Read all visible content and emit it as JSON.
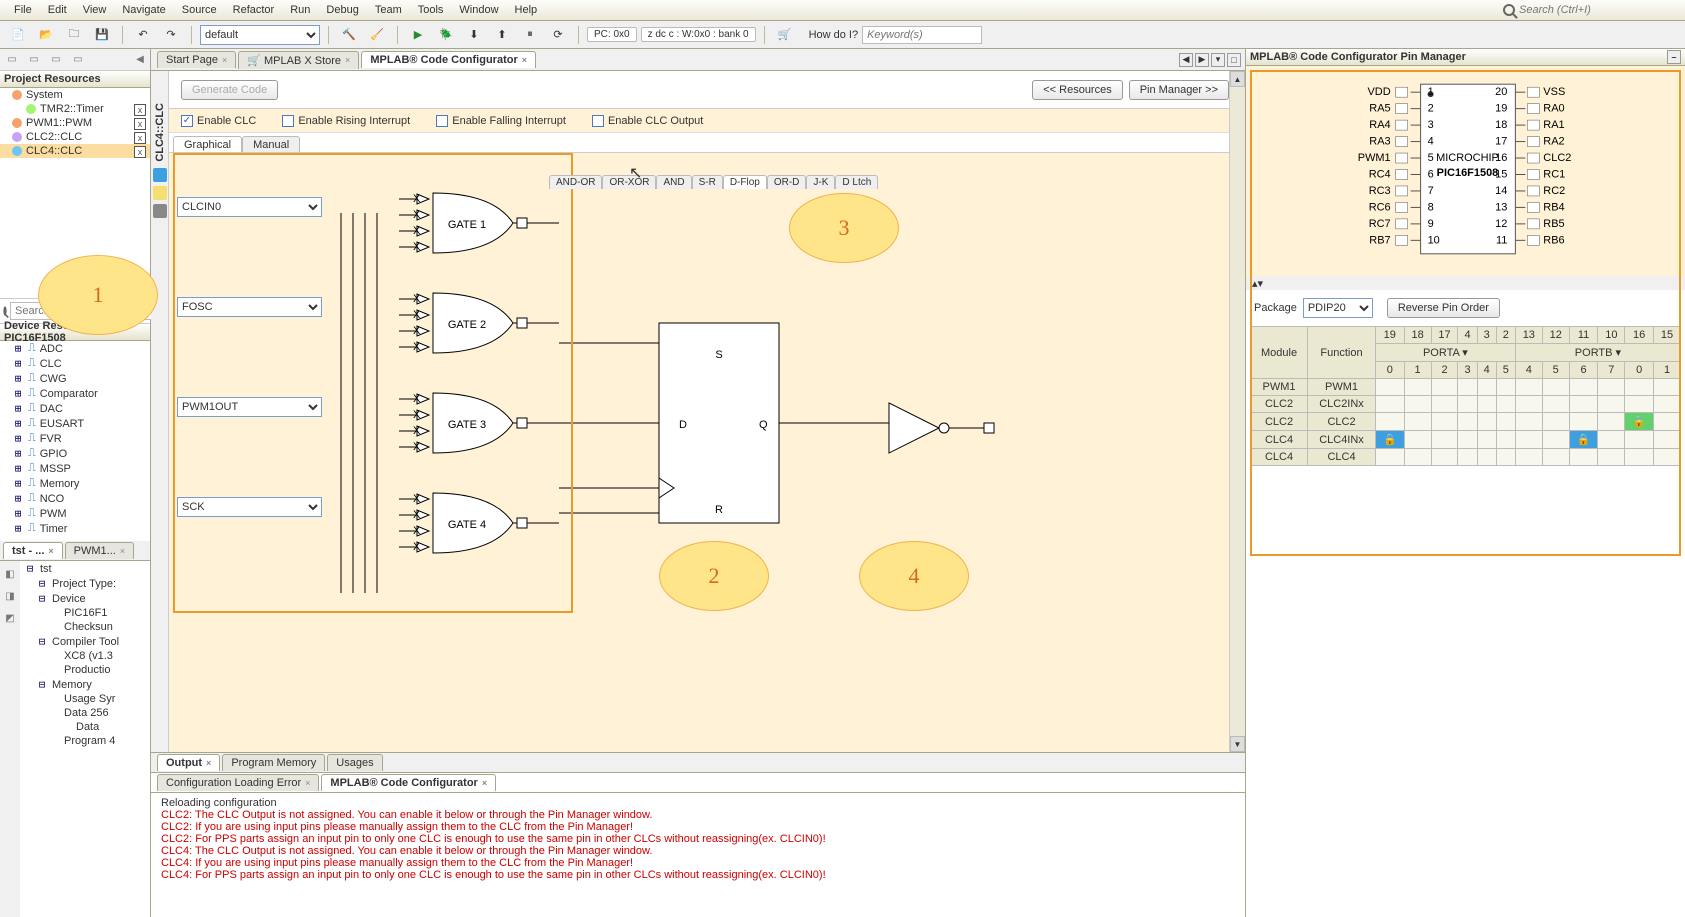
{
  "menubar": [
    "File",
    "Edit",
    "View",
    "Navigate",
    "Source",
    "Refactor",
    "Run",
    "Debug",
    "Team",
    "Tools",
    "Window",
    "Help"
  ],
  "search_placeholder": "Search (Ctrl+I)",
  "toolbar_combo": "default",
  "status_pc": "PC: 0x0",
  "status_bank": "z dc c  : W:0x0 : bank 0",
  "howdo_label": "How do I?",
  "howdo_placeholder": "Keyword(s)",
  "project_resources_title": "Project Resources",
  "project_resources": [
    {
      "label": "System",
      "indent": 0,
      "closable": false
    },
    {
      "label": "TMR2::Timer",
      "indent": 1,
      "closable": true
    },
    {
      "label": "PWM1::PWM",
      "indent": 0,
      "closable": true
    },
    {
      "label": "CLC2::CLC",
      "indent": 0,
      "closable": true
    },
    {
      "label": "CLC4::CLC",
      "indent": 0,
      "sel": true,
      "closable": true
    }
  ],
  "search_modules_ph": "Search for modules…",
  "device_res_title": "Device Resources - PIC16F1508",
  "device_list": [
    "ADC",
    "CLC",
    "CWG",
    "Comparator",
    "DAC",
    "EUSART",
    "FVR",
    "GPIO",
    "MSSP",
    "Memory",
    "NCO",
    "PWM",
    "Timer"
  ],
  "nav_tabs": [
    "tst - ...",
    "PWM1..."
  ],
  "nav_tree": [
    {
      "l": "tst",
      "i": 0
    },
    {
      "l": "Project Type:",
      "i": 1
    },
    {
      "l": "Device",
      "i": 1
    },
    {
      "l": "PIC16F1",
      "i": 2
    },
    {
      "l": "Checksun",
      "i": 2
    },
    {
      "l": "Compiler Tool",
      "i": 1
    },
    {
      "l": "XC8 (v1.3",
      "i": 2
    },
    {
      "l": "Productio",
      "i": 2
    },
    {
      "l": "Memory",
      "i": 1
    },
    {
      "l": "Usage Syr",
      "i": 2
    },
    {
      "l": "Data 256",
      "i": 2
    },
    {
      "l": "Data",
      "i": 3
    },
    {
      "l": "Program 4",
      "i": 2
    }
  ],
  "editor_tabs": [
    {
      "label": "Start Page"
    },
    {
      "label": "MPLAB X Store",
      "icon": true
    },
    {
      "label": "MPLAB® Code Configurator",
      "active": true
    }
  ],
  "gen_btn": "Generate Code",
  "res_btn": "<< Resources",
  "pin_btn": "Pin Manager >>",
  "opts": [
    {
      "label": "Enable CLC",
      "checked": true
    },
    {
      "label": "Enable Rising Interrupt",
      "checked": false
    },
    {
      "label": "Enable Falling Interrupt",
      "checked": false
    },
    {
      "label": "Enable CLC Output",
      "checked": false
    }
  ],
  "clc_vertical": "CLC4::CLC",
  "sub_tabs": [
    "Graphical",
    "Manual"
  ],
  "logic_tabs": [
    "AND-OR",
    "OR-XOR",
    "AND",
    "S-R",
    "D-Flop",
    "OR-D",
    "J-K",
    "D Ltch"
  ],
  "inputs": [
    "CLCIN0",
    "FOSC",
    "PWM1OUT",
    "SCK"
  ],
  "gates": [
    "GATE 1",
    "GATE 2",
    "GATE 3",
    "GATE 4"
  ],
  "ff": {
    "S": "S",
    "D": "D",
    "Q": "Q",
    "R": "R"
  },
  "bottom_tabs": [
    "Output",
    "Program Memory",
    "Usages"
  ],
  "sub_bottom_tabs": [
    "Configuration Loading Error",
    "MPLAB® Code Configurator"
  ],
  "console": [
    {
      "t": "Reloading configuration"
    },
    {
      "t": "CLC2: The CLC Output is not assigned. You can enable it below or through the Pin Manager window.",
      "c": "c-red"
    },
    {
      "t": "CLC2: If you are using input pins please manually assign them to the CLC from the Pin Manager!",
      "c": "c-red"
    },
    {
      "t": "CLC2: For PPS parts assign an input pin to only one CLC is enough to use the same pin in other CLCs without reassigning(ex. CLCIN0)!",
      "c": "c-red"
    },
    {
      "t": "CLC4: The CLC Output is not assigned. You can enable it below or through the Pin Manager window.",
      "c": "c-red"
    },
    {
      "t": "CLC4: If you are using input pins please manually assign them to the CLC from the Pin Manager!",
      "c": "c-red"
    },
    {
      "t": "CLC4: For PPS parts assign an input pin to only one CLC is enough to use the same pin in other CLCs without reassigning(ex. CLCIN0)!",
      "c": "c-red"
    }
  ],
  "pin_mgr_title": "MPLAB® Code Configurator Pin Manager",
  "chip_name": "PIC16F1508",
  "chip_pins_l": [
    {
      "n": "1",
      "name": "VDD",
      "c": null
    },
    {
      "n": "2",
      "name": "RA5",
      "c": null
    },
    {
      "n": "3",
      "name": "RA4",
      "c": null
    },
    {
      "n": "4",
      "name": "RA3",
      "c": null
    },
    {
      "n": "5",
      "name": "PWM1",
      "c": "green"
    },
    {
      "n": "6",
      "name": "RC4",
      "c": null
    },
    {
      "n": "7",
      "name": "RC3",
      "c": null
    },
    {
      "n": "8",
      "name": "RC6",
      "c": null
    },
    {
      "n": "9",
      "name": "RC7",
      "c": null
    },
    {
      "n": "10",
      "name": "RB7",
      "c": null
    }
  ],
  "chip_pins_r": [
    {
      "n": "20",
      "name": "VSS",
      "c": null
    },
    {
      "n": "19",
      "name": "RA0",
      "c": null
    },
    {
      "n": "18",
      "name": "RA1",
      "c": null
    },
    {
      "n": "17",
      "name": "RA2",
      "c": null
    },
    {
      "n": "16",
      "name": "CLC2",
      "c": "yellow"
    },
    {
      "n": "15",
      "name": "RC1",
      "c": null
    },
    {
      "n": "14",
      "name": "RC2",
      "c": null
    },
    {
      "n": "13",
      "name": "RB4",
      "c": null
    },
    {
      "n": "12",
      "name": "RB5",
      "c": null
    },
    {
      "n": "11",
      "name": "RB6",
      "c": null
    }
  ],
  "package_label": "Package",
  "package_sel": "PDIP20",
  "reverse_btn": "Reverse Pin Order",
  "pin_cols": [
    "19",
    "18",
    "17",
    "4",
    "3",
    "2",
    "13",
    "12",
    "11",
    "10",
    "16",
    "15"
  ],
  "port_groups": [
    "PORTA ▾",
    "PORTB ▾"
  ],
  "bit_cols": [
    "0",
    "1",
    "2",
    "3",
    "4",
    "5",
    "4",
    "5",
    "6",
    "7",
    "0",
    "1"
  ],
  "mod_head": "Module",
  "fun_head": "Function",
  "pin_rows": [
    {
      "m": "PWM1",
      "f": "PWM1",
      "cells": [
        0,
        0,
        0,
        0,
        0,
        0,
        0,
        0,
        0,
        0,
        0,
        0
      ]
    },
    {
      "m": "CLC2",
      "f": "CLC2INx",
      "cells": [
        0,
        0,
        0,
        0,
        0,
        0,
        0,
        0,
        0,
        0,
        0,
        0
      ]
    },
    {
      "m": "CLC2",
      "f": "CLC2",
      "cells": [
        0,
        0,
        0,
        0,
        0,
        0,
        0,
        0,
        0,
        0,
        2,
        0
      ]
    },
    {
      "m": "CLC4",
      "f": "CLC4INx",
      "cells": [
        1,
        0,
        0,
        0,
        0,
        0,
        0,
        0,
        1,
        0,
        0,
        0
      ]
    },
    {
      "m": "CLC4",
      "f": "CLC4",
      "cells": [
        0,
        0,
        0,
        0,
        0,
        0,
        0,
        0,
        0,
        0,
        0,
        0
      ]
    }
  ],
  "callouts": [
    "1",
    "2",
    "3",
    "4"
  ]
}
